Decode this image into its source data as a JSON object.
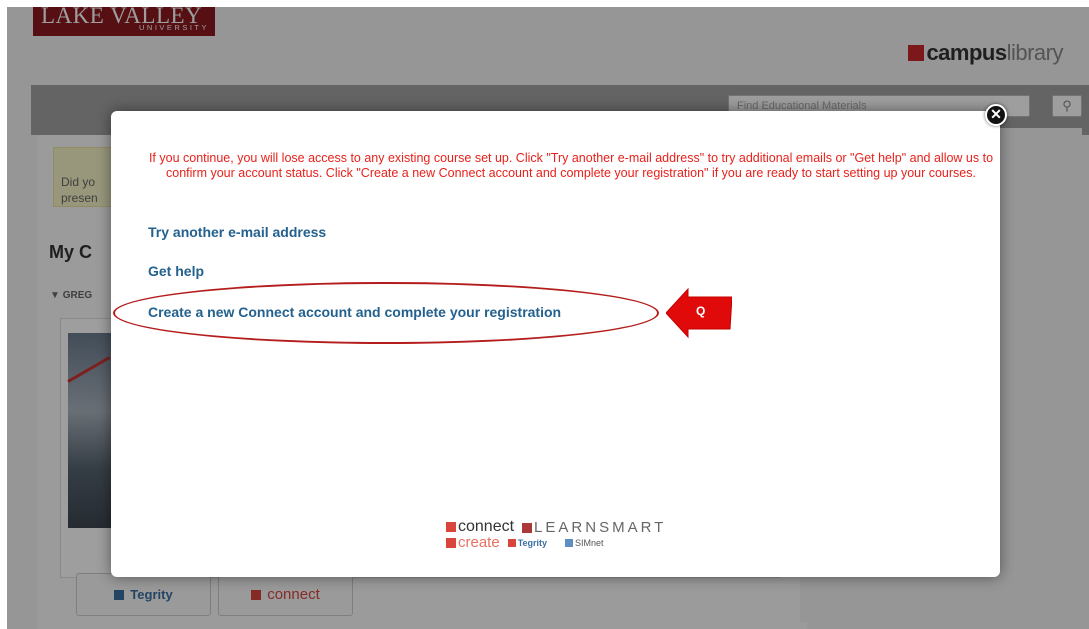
{
  "header": {
    "logo_main": "LAKE VALLEY",
    "logo_sub": "UNIVERSITY",
    "campus_word": "campus",
    "library_word": "library",
    "search_placeholder": "Find Educational Materials"
  },
  "background": {
    "notice_text": "Did yo\npresen",
    "my_courses_heading": "My C",
    "section_toggle": "GREG",
    "tool_buttons": [
      {
        "label": "Tegrity"
      },
      {
        "label": "connect"
      }
    ]
  },
  "modal": {
    "warning_text": "If you continue, you will lose access to any existing course set up. Click \"Try another e-mail address\" to try additional emails or \"Get help\" and allow us to confirm your account status. Click \"Create a new Connect account and complete your registration\" if you are ready to start setting up your courses.",
    "links": {
      "try_another": "Try another e-mail address",
      "get_help": "Get help",
      "create_account": "Create a new Connect account and complete your registration"
    },
    "callout_letter": "Q",
    "close_symbol": "✕",
    "brands": {
      "connect": "connect",
      "learnsmart": "LEARNSMART",
      "create": "create",
      "tegrity": "Tegrity",
      "simnet": "SIMnet"
    }
  },
  "colors": {
    "warning_red": "#e8211b",
    "link_blue": "#23618e",
    "annotation_red": "#b51c1c",
    "brand_red": "#d9453c"
  }
}
